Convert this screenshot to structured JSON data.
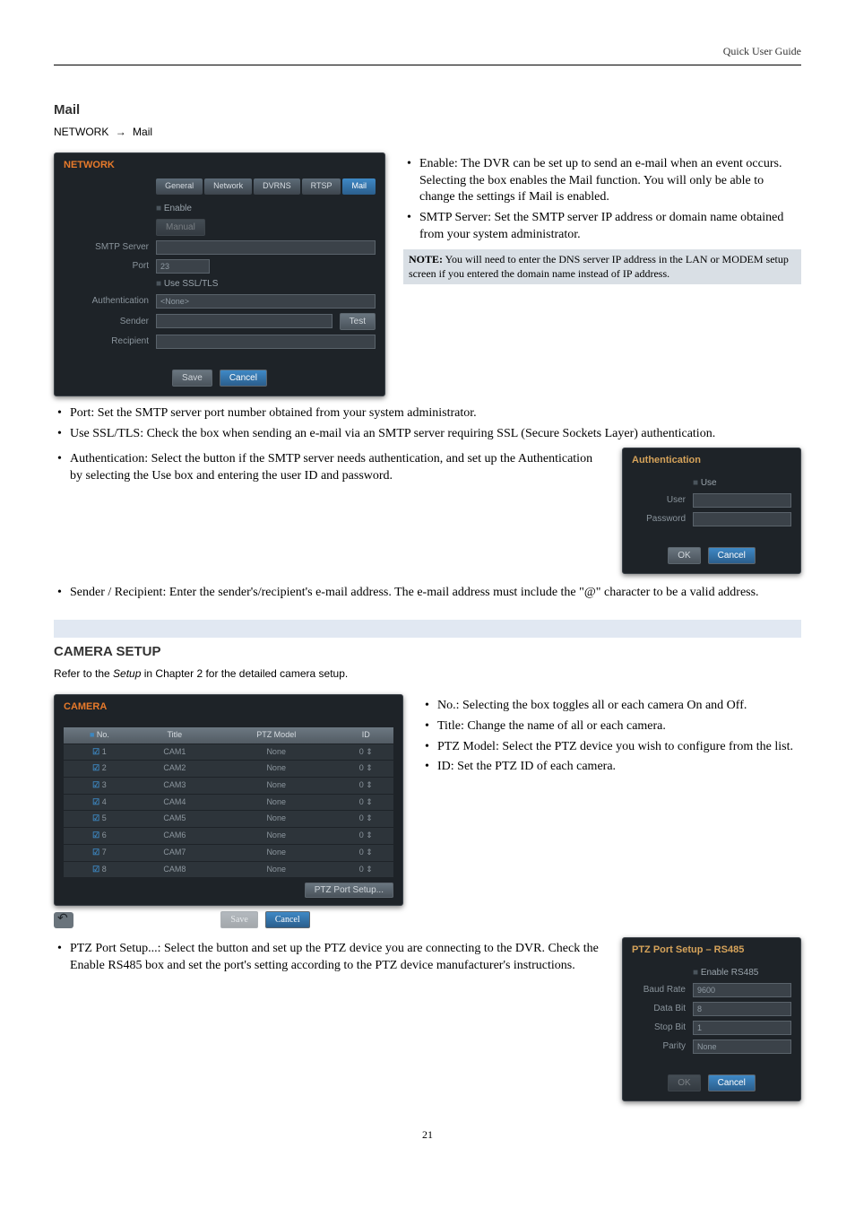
{
  "header": {
    "right_text": "Quick User Guide"
  },
  "page_number": "21",
  "mail_section": {
    "title": "Mail",
    "breadcrumb": {
      "a": "NETWORK",
      "arrow": "→",
      "b": "Mail"
    },
    "dialog": {
      "title": "NETWORK",
      "tabs": [
        "General",
        "Network",
        "DVRNS",
        "RTSP",
        "Mail"
      ],
      "active_tab": 4,
      "enable_label": "Enable",
      "manual_label": "Manual",
      "fields": {
        "smtp_server_label": "SMTP Server",
        "smtp_server_value": "",
        "port_label": "Port",
        "port_value": "23",
        "use_ssl_label": "Use SSL/TLS",
        "auth_label": "Authentication",
        "auth_value": "<None>",
        "sender_label": "Sender",
        "sender_value": "",
        "recipient_label": "Recipient",
        "recipient_value": ""
      },
      "test_btn": "Test",
      "save_btn": "Save",
      "cancel_btn": "Cancel"
    },
    "bullets_right": [
      {
        "k": "Enable",
        "t": ": The DVR can be set up to send an e-mail when an event occurs.  Selecting the box enables the Mail function.  You will only be able to change the settings if Mail is enabled."
      },
      {
        "k": "SMTP Server",
        "t": ": Set the SMTP server IP address or domain name obtained from your system administrator."
      }
    ],
    "note": {
      "label": "NOTE:",
      "text": "You will need to enter the DNS server IP address in the LAN or MODEM setup screen if you entered the domain name instead of IP address."
    },
    "bullets_below": [
      {
        "k": "Port",
        "t": ":  Set the SMTP server port number obtained from your system administrator."
      },
      {
        "k": "Use SSL/TLS",
        "t": ":  Check the box when sending an e-mail via an SMTP server requiring SSL (Secure Sockets Layer) authentication."
      }
    ],
    "auth_bullet": {
      "k": "Authentication",
      "t": ": Select the button if the SMTP server needs authentication, and set up the Authentication by selecting the ",
      "k2": "Use",
      "t2": " box and entering the user ID and password."
    },
    "auth_dialog": {
      "title": "Authentication",
      "use_label": "Use",
      "user_label": "User",
      "password_label": "Password",
      "ok_btn": "OK",
      "cancel_btn": "Cancel"
    },
    "sender_bullet": {
      "k1": "Sender",
      "slash": " / ",
      "k2": "Recipient",
      "t1": ": Enter the sender's/recipient's e-mail address.  The e-mail address must include the \"",
      "at": "@",
      "t2": "\" character to be a valid address."
    }
  },
  "camera_section": {
    "heading": "CAMERA SETUP",
    "breadcrumb_note_part1": "Refer to the ",
    "breadcrumb_note_em": "Setup",
    "breadcrumb_note_part2": " in Chapter 2 for the detailed camera setup.",
    "dialog": {
      "title": "CAMERA",
      "columns": [
        "No.",
        "Title",
        "PTZ Model",
        "ID"
      ],
      "rows": [
        {
          "no": "1",
          "title": "CAM1",
          "ptz": "None",
          "id": "0"
        },
        {
          "no": "2",
          "title": "CAM2",
          "ptz": "None",
          "id": "0"
        },
        {
          "no": "3",
          "title": "CAM3",
          "ptz": "None",
          "id": "0"
        },
        {
          "no": "4",
          "title": "CAM4",
          "ptz": "None",
          "id": "0"
        },
        {
          "no": "5",
          "title": "CAM5",
          "ptz": "None",
          "id": "0"
        },
        {
          "no": "6",
          "title": "CAM6",
          "ptz": "None",
          "id": "0"
        },
        {
          "no": "7",
          "title": "CAM7",
          "ptz": "None",
          "id": "0"
        },
        {
          "no": "8",
          "title": "CAM8",
          "ptz": "None",
          "id": "0"
        }
      ],
      "ptz_port_btn": "PTZ Port Setup...",
      "save_btn": "Save",
      "cancel_btn": "Cancel"
    },
    "right_bullets": [
      {
        "k": "No.",
        "t": ": Selecting the box toggles all or each camera On and Off."
      },
      {
        "k": "Title",
        "t": ": Change the name of all or each camera."
      },
      {
        "k": "PTZ Model",
        "t": ": Select the PTZ device you wish to configure from the list."
      },
      {
        "k": "ID",
        "t": ": Set the PTZ ID of each camera."
      }
    ],
    "ptz_bullet": {
      "k": "PTZ Port Setup...",
      "t1": ": Select the button and set up the PTZ device you are connecting to the DVR.  Check the ",
      "k2": "Enable RS485",
      "t2": " box and set the port's setting according to the PTZ device manufacturer's instructions."
    },
    "ptz_dialog": {
      "title": "PTZ Port Setup – RS485",
      "enable_label": "Enable RS485",
      "rows": {
        "baud_label": "Baud Rate",
        "baud_value": "9600",
        "data_label": "Data Bit",
        "data_value": "8",
        "stop_label": "Stop Bit",
        "stop_value": "1",
        "parity_label": "Parity",
        "parity_value": "None"
      },
      "ok_btn": "OK",
      "cancel_btn": "Cancel"
    }
  }
}
